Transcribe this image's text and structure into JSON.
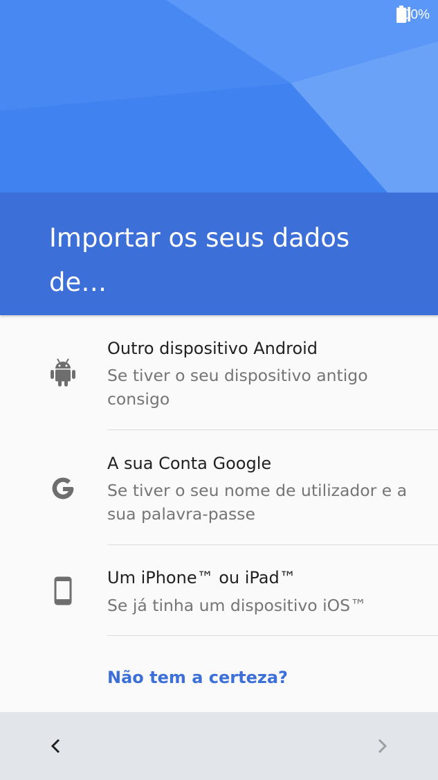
{
  "status_bar": {
    "battery_percent": "100%",
    "icons": [
      "signal-icon",
      "battery-icon"
    ]
  },
  "title": {
    "line1": "Importar os seus dados",
    "line2": "de…"
  },
  "options": [
    {
      "icon": "android-icon",
      "title": "Outro dispositivo Android",
      "description": "Se tiver o seu dispositivo antigo consigo"
    },
    {
      "icon": "google-icon",
      "title": "A sua Conta Google",
      "description": "Se tiver o seu nome de utilizador e a sua palavra-passe"
    },
    {
      "icon": "phone-icon",
      "title": "Um iPhone™ ou iPad™",
      "description": "Se já tinha um dispositivo iOS™"
    }
  ],
  "unsure_link": "Não tem a certeza?",
  "navigation": {
    "back_icon": "chevron-left-icon",
    "next_icon": "chevron-right-icon"
  },
  "colors": {
    "hero": "#4a8cf5",
    "title_band": "#3d6fd8",
    "link": "#3d6fd8",
    "nav_bar": "#e2e6ea"
  }
}
